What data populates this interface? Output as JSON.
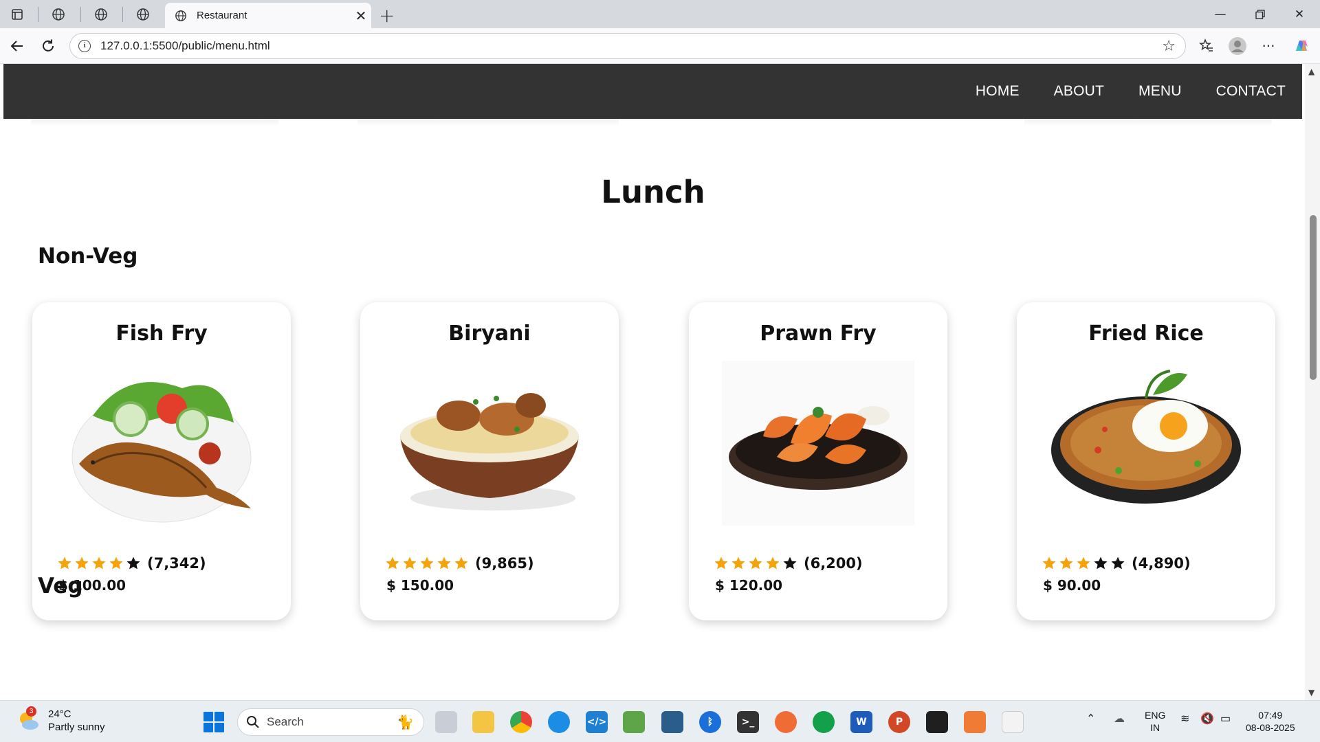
{
  "browser": {
    "tab_title": "Restaurant",
    "url": "127.0.0.1:5500/public/menu.html"
  },
  "site_nav": {
    "items": [
      "HOME",
      "ABOUT",
      "MENU",
      "CONTACT"
    ]
  },
  "menu": {
    "section_title": "Lunch",
    "category_nonveg": "Non-Veg",
    "category_veg": "Veg",
    "cards": [
      {
        "name": "Fish Fry",
        "stars_filled": 4,
        "stars_total": 5,
        "reviews": "(7,342)",
        "price": "$ 100.00"
      },
      {
        "name": "Biryani",
        "stars_filled": 5,
        "stars_total": 5,
        "reviews": "(9,865)",
        "price": "$ 150.00"
      },
      {
        "name": "Prawn Fry",
        "stars_filled": 4,
        "stars_total": 5,
        "reviews": "(6,200)",
        "price": "$ 120.00"
      },
      {
        "name": "Fried Rice",
        "stars_filled": 3,
        "stars_total": 5,
        "reviews": "(4,890)",
        "price": "$ 90.00"
      }
    ],
    "star_color": "#f5a30a"
  },
  "taskbar": {
    "weather_badge": "3",
    "temperature": "24°C",
    "weather_desc": "Partly sunny",
    "search_placeholder": "Search",
    "lang_line1": "ENG",
    "lang_line2": "IN",
    "time": "07:49",
    "date": "08-08-2025"
  }
}
